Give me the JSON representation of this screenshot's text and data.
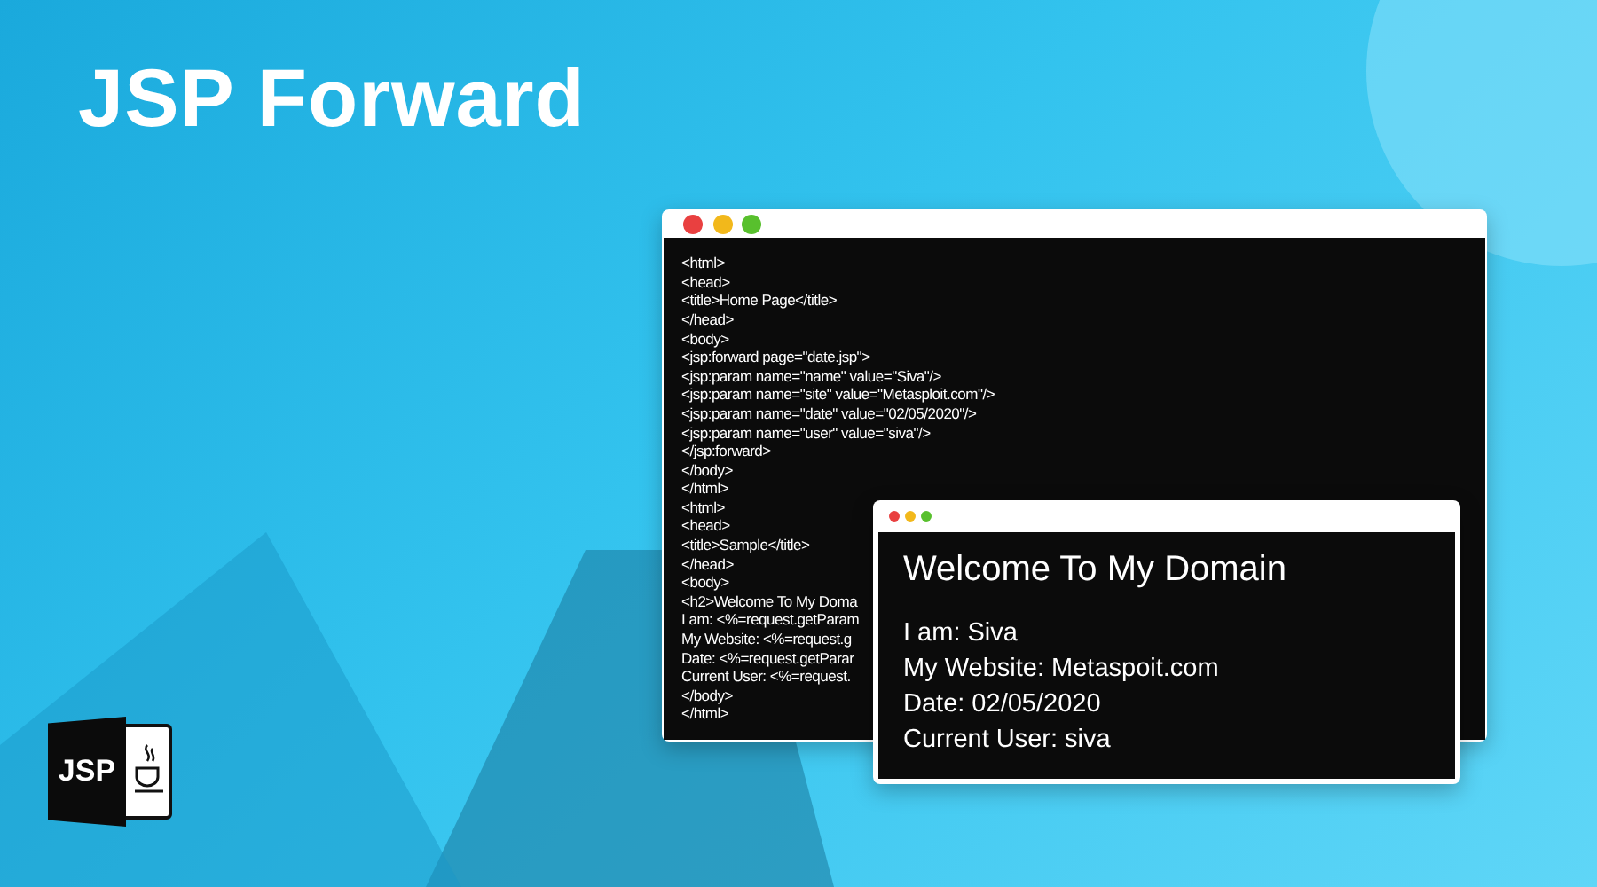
{
  "title": "JSP Forward",
  "code_window": {
    "lines": [
      "<html>",
      "<head>",
      "<title>Home Page</title>",
      "</head>",
      "<body>",
      "<jsp:forward page=\"date.jsp\">",
      "<jsp:param name=\"name\" value=\"Siva\"/>",
      "<jsp:param name=\"site\" value=\"Metasploit.com\"/>",
      "<jsp:param name=\"date\" value=\"02/05/2020\"/>",
      "<jsp:param name=\"user\" value=\"siva\"/>",
      "</jsp:forward>",
      "</body>",
      "</html>",
      "<html>",
      "<head>",
      "<title>Sample</title>",
      "</head>",
      "<body>",
      "<h2>Welcome To My Doma",
      "I am: <%=request.getParam",
      "My Website: <%=request.g",
      "Date: <%=request.getParar",
      "Current User: <%=request.",
      "</body>",
      "</html>"
    ]
  },
  "output_window": {
    "heading": "Welcome To My Domain",
    "lines": [
      "I am: Siva",
      "My Website: Metaspoit.com",
      "Date: 02/05/2020",
      "Current User: siva"
    ]
  },
  "logo": {
    "text": "JSP"
  }
}
